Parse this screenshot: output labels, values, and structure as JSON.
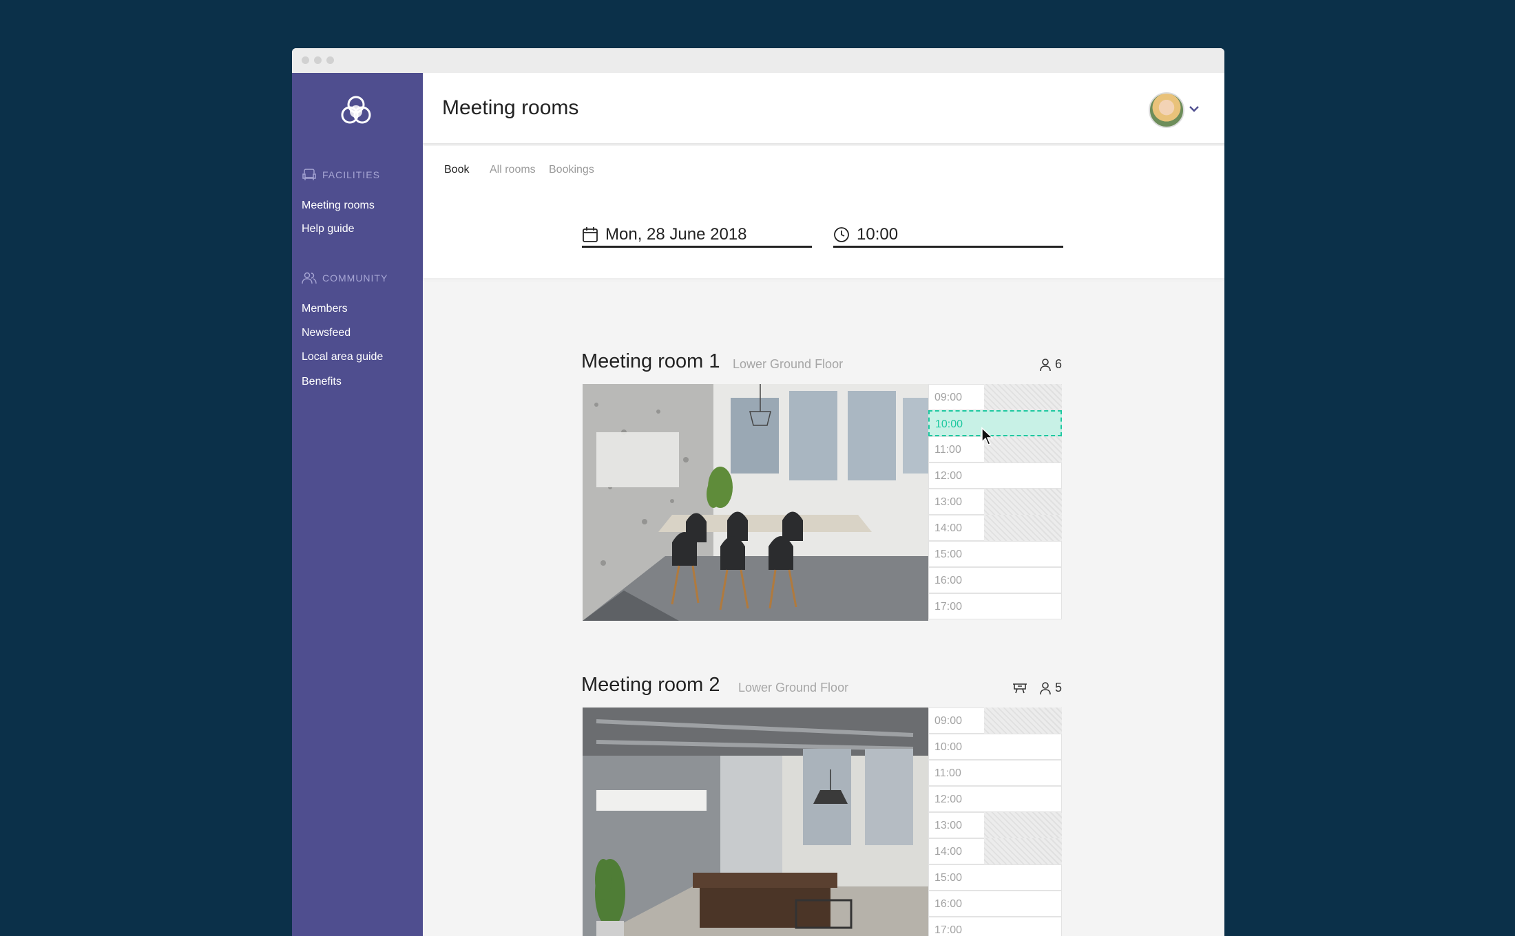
{
  "sidebar": {
    "sections": [
      {
        "heading": "Facilities",
        "icon": "armchair-icon",
        "items": [
          "Meeting rooms",
          "Help guide"
        ]
      },
      {
        "heading": "Community",
        "icon": "people-icon",
        "items": [
          "Members",
          "Newsfeed",
          "Local area guide",
          "Benefits"
        ]
      }
    ]
  },
  "header": {
    "title": "Meeting rooms",
    "avatar": "user-avatar"
  },
  "tabs": [
    "Book",
    "All rooms",
    "Bookings"
  ],
  "active_tab": "Book",
  "filters": {
    "date": "Mon, 28 June 2018",
    "time": "10:00"
  },
  "rooms": [
    {
      "name": "Meeting room 1",
      "floor": "Lower Ground Floor",
      "capacity": "6",
      "has_projector": false,
      "slots": [
        "09:00",
        "10:00",
        "11:00",
        "12:00",
        "13:00",
        "14:00",
        "15:00",
        "16:00",
        "17:00"
      ],
      "busy": [
        "09:00",
        "11:00",
        "13:00",
        "14:00"
      ],
      "selected": "10:00"
    },
    {
      "name": "Meeting room 2",
      "floor": "Lower Ground Floor",
      "capacity": "5",
      "has_projector": true,
      "slots": [
        "09:00",
        "10:00",
        "11:00",
        "12:00",
        "13:00",
        "14:00",
        "15:00",
        "16:00",
        "17:00"
      ],
      "busy": [
        "09:00",
        "13:00",
        "14:00"
      ],
      "selected": null
    }
  ],
  "colors": {
    "sidebar": "#4f4e8f",
    "background": "#0b3049",
    "accent": "#1ec8a0"
  }
}
